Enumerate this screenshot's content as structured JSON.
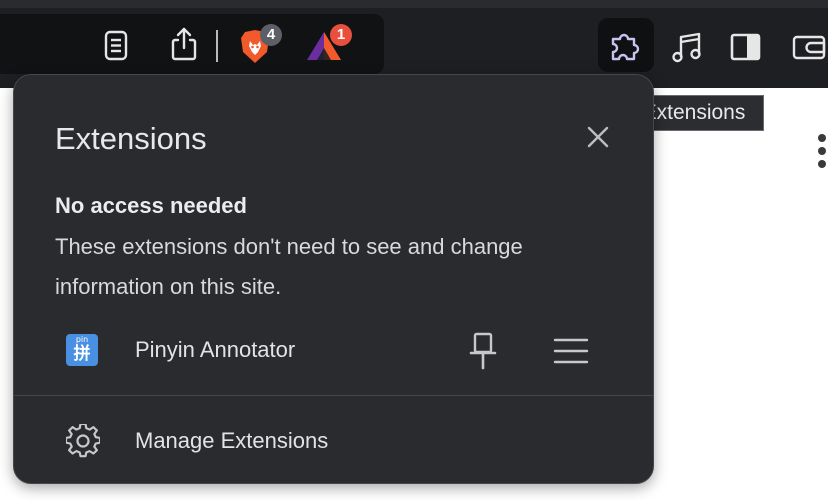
{
  "toolbar": {
    "brave_shields_count": "4",
    "brave_rewards_count": "1",
    "icons": [
      "reader-mode-icon",
      "share-icon",
      "brave-shields-icon",
      "brave-rewards-icon",
      "extensions-icon",
      "music-icon",
      "sidebar-icon",
      "wallet-icon"
    ]
  },
  "tooltip": {
    "text": "Extensions"
  },
  "panel": {
    "title": "Extensions",
    "section_title": "No access needed",
    "description": "These extensions don't need to see and change information on this site.",
    "extension": {
      "name": "Pinyin Annotator",
      "icon_top_text": "pin",
      "icon_main_text": "拼",
      "icon_color": "#4a90e2"
    },
    "manage_label": "Manage Extensions"
  },
  "colors": {
    "panel_bg": "#2a2b2f",
    "toolbar_bg": "#1e1f22",
    "badge_red": "#e8503d",
    "brave_orange": "#f2592b"
  }
}
